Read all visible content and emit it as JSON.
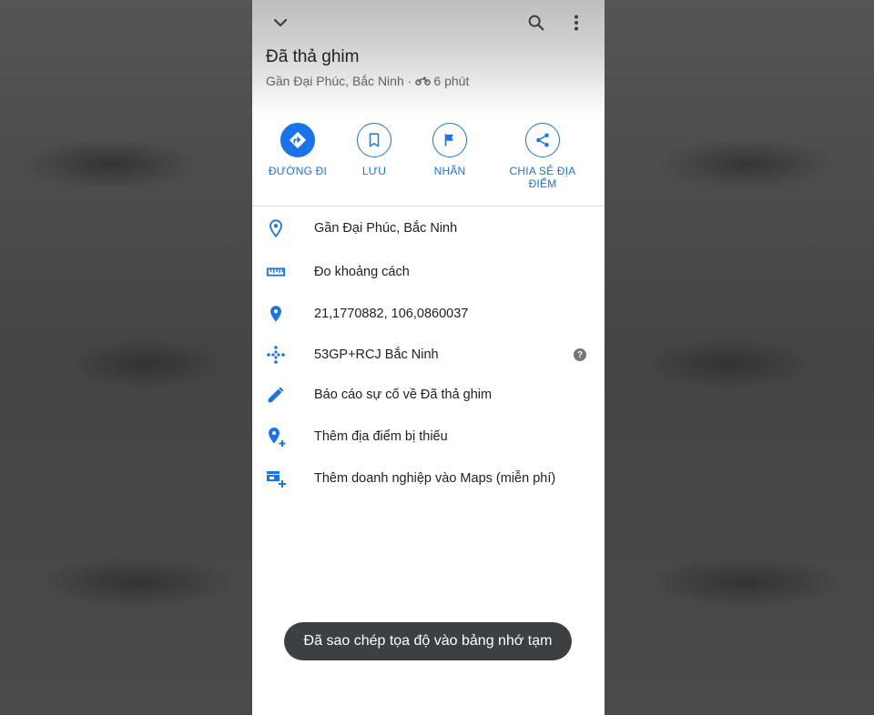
{
  "header": {
    "title": "Đã thả ghim",
    "location": "Gần Đại Phúc, Bắc Ninh",
    "separator": "·",
    "travel_time": "6 phút",
    "icons": [
      "chevron-down-icon",
      "search-icon",
      "more-vert-icon",
      "motorcycle-icon"
    ]
  },
  "actions": [
    {
      "label": "ĐƯỜNG ĐI",
      "icon": "directions-icon"
    },
    {
      "label": "LƯU",
      "icon": "bookmark-icon"
    },
    {
      "label": "NHÃN",
      "icon": "flag-icon"
    },
    {
      "label": "CHIA SẺ ĐỊA ĐIỂM",
      "icon": "share-icon"
    }
  ],
  "details": [
    {
      "text": "Gần Đại Phúc, Bắc Ninh",
      "icon": "location-outline-icon"
    },
    {
      "text": "Đo khoảng cách",
      "icon": "ruler-icon"
    },
    {
      "text": "21,1770882, 106,0860037",
      "icon": "location-pin-icon"
    },
    {
      "text": "53GP+RCJ Bắc Ninh",
      "icon": "plus-code-icon",
      "help": "?"
    },
    {
      "text": "Báo cáo sự cố về Đã thả ghim",
      "icon": "pencil-icon"
    },
    {
      "text": "Thêm địa điểm bị thiếu",
      "icon": "add-location-icon"
    },
    {
      "text": "Thêm doanh nghiệp vào Maps (miễn phí)",
      "icon": "add-business-icon"
    }
  ],
  "toast": {
    "text": "Đã sao chép tọa độ vào bảng nhớ tạm"
  },
  "colors": {
    "accent": "#1a73e8",
    "text": "#202124",
    "secondary": "#5f6368",
    "toast_bg": "#3c4043"
  }
}
